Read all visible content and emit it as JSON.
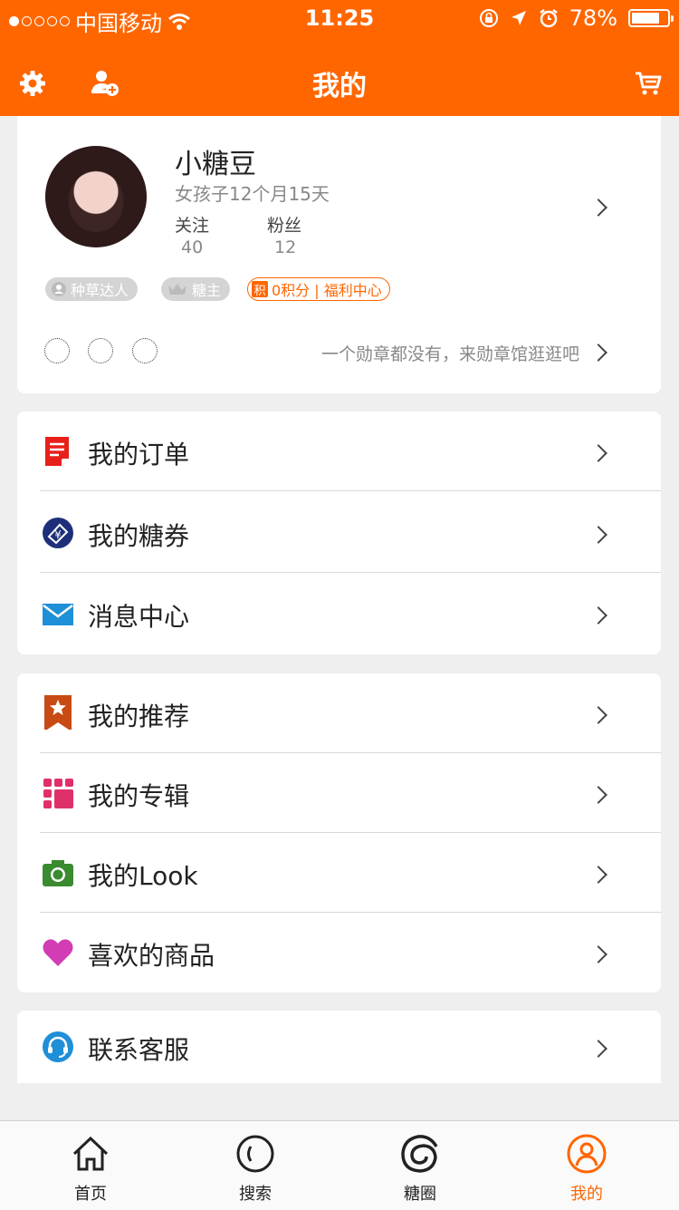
{
  "status_bar": {
    "carrier": "中国移动",
    "time": "11:25",
    "battery": "78%",
    "battery_level": 0.78
  },
  "nav": {
    "title": "我的",
    "settings_icon": "gear-icon",
    "add_friend_icon": "add-user-icon",
    "cart_icon": "cart-icon"
  },
  "profile": {
    "name": "小糖豆",
    "age": "女孩子12个月15天",
    "following_label": "关注",
    "following": "40",
    "fans_label": "粉丝",
    "fans": "12",
    "tags": [
      "种草达人",
      "糖主"
    ],
    "points_icon": "积",
    "points": "0积分 | 福利中心",
    "badge_hint": "一个勋章都没有，来勋章馆逛逛吧"
  },
  "menu_group1": [
    {
      "label": "我的订单",
      "icon": "order-icon",
      "color": "#e8201a"
    },
    {
      "label": "我的糖券",
      "icon": "coupon-icon",
      "color": "#1e2f7a"
    },
    {
      "label": "消息中心",
      "icon": "mail-icon",
      "color": "#1f8fd8"
    }
  ],
  "menu_group2": [
    {
      "label": "我的推荐",
      "icon": "bookmark-star-icon",
      "color": "#c84a14"
    },
    {
      "label": "我的专辑",
      "icon": "album-grid-icon",
      "color": "#e0306a"
    },
    {
      "label": "我的Look",
      "icon": "camera-icon",
      "color": "#3a8a30"
    },
    {
      "label": "喜欢的商品",
      "icon": "heart-icon",
      "color": "#d23cb4"
    }
  ],
  "menu_group3": [
    {
      "label": "联系客服",
      "icon": "headset-icon",
      "color": "#1f8fd8"
    }
  ],
  "tabbar": [
    {
      "label": "首页",
      "icon": "home-icon"
    },
    {
      "label": "搜索",
      "icon": "search-icon"
    },
    {
      "label": "糖圈",
      "icon": "swirl-icon"
    },
    {
      "label": "我的",
      "icon": "profile-icon",
      "active": true
    }
  ],
  "colors": {
    "accent": "#ff6600",
    "background": "#efefef"
  }
}
